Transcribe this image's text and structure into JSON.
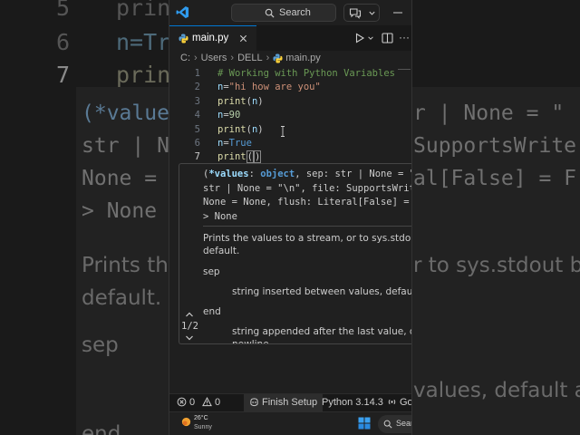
{
  "backdrop": {
    "line_numbers": [
      "5",
      "6",
      "7"
    ],
    "code_fragments": [
      "prin",
      "n=Tru",
      "prin"
    ],
    "sig_lines": [
      "(*value",
      "r | None = \"",
      "str | N",
      "SupportsWrite",
      "None =",
      "al[False] = F",
      "> None"
    ],
    "doc_lines": [
      "Prints th",
      "r to sys.stdout by",
      "default.",
      "sep",
      "values, default a",
      "end"
    ],
    "sig_prefix": "(*value",
    "sig_prefix_tail": "s"
  },
  "titlebar": {
    "search_label": "Search"
  },
  "tab": {
    "label": "main.py",
    "more": "···"
  },
  "breadcrumb": [
    "C:",
    "Users",
    "DELL",
    "main.py"
  ],
  "editor": {
    "lines": [
      {
        "num": "1",
        "tokens": [
          {
            "t": "# Working with Python Variables",
            "c": "comment"
          }
        ]
      },
      {
        "num": "2",
        "tokens": [
          {
            "t": "n",
            "c": "var"
          },
          {
            "t": "=",
            "c": "punc"
          },
          {
            "t": "\"hi how are you\"",
            "c": "str"
          }
        ]
      },
      {
        "num": "3",
        "tokens": [
          {
            "t": "print",
            "c": "fn"
          },
          {
            "t": "(",
            "c": "punc"
          },
          {
            "t": "n",
            "c": "var"
          },
          {
            "t": ")",
            "c": "punc"
          }
        ]
      },
      {
        "num": "4",
        "tokens": [
          {
            "t": "n",
            "c": "var"
          },
          {
            "t": "=",
            "c": "punc"
          },
          {
            "t": "90",
            "c": "num"
          }
        ]
      },
      {
        "num": "5",
        "tokens": [
          {
            "t": "print",
            "c": "fn"
          },
          {
            "t": "(",
            "c": "punc"
          },
          {
            "t": "n",
            "c": "var"
          },
          {
            "t": ")",
            "c": "punc"
          }
        ]
      },
      {
        "num": "6",
        "tokens": [
          {
            "t": "n",
            "c": "var"
          },
          {
            "t": "=",
            "c": "punc"
          },
          {
            "t": "True",
            "c": "kw"
          }
        ]
      },
      {
        "num": "7",
        "tokens": [
          {
            "t": "print",
            "c": "fn"
          },
          {
            "t": "(",
            "c": "punc"
          },
          {
            "t": ")",
            "c": "punc"
          }
        ]
      }
    ]
  },
  "hover": {
    "signature": [
      [
        {
          "t": "(",
          "c": "punc"
        },
        {
          "t": "*values",
          "c": "var"
        },
        {
          "t": ": ",
          "c": "punc"
        },
        {
          "t": "object",
          "c": "kw"
        },
        {
          "t": ", sep: str | None = \"",
          "c": "punc"
        }
      ],
      [
        {
          "t": "str | None = \"\\n\", file: SupportsWrite",
          "c": "punc"
        }
      ],
      [
        {
          "t": "None = None, flush: Literal[False] = F",
          "c": "punc"
        }
      ],
      [
        {
          "t": "> None",
          "c": "punc"
        }
      ]
    ],
    "doc": {
      "summary_1": "Prints the values to a stream, or to sys.stdout by",
      "summary_2": "default.",
      "sep_label": "sep",
      "sep_desc": "string inserted between values, default a",
      "end_label": "end",
      "end_desc_1": "string appended after the last value, defa",
      "end_desc_2": "newline"
    },
    "pager": "1/2"
  },
  "statusbar": {
    "errors": "0",
    "warnings": "0",
    "finish_setup": "Finish Setup",
    "python": "Python 3.14.3",
    "go": "Go"
  },
  "taskbar": {
    "temp": "26°C",
    "condition": "Sunny",
    "search": "Search"
  },
  "colors": {
    "accent": "#0078d4",
    "editor_bg": "#1f1f1f",
    "comment": "#6a9955",
    "string": "#ce9178",
    "number": "#b5cea8",
    "function": "#dcdcaa",
    "variable": "#9cdcfe",
    "keyword": "#569cd6"
  }
}
